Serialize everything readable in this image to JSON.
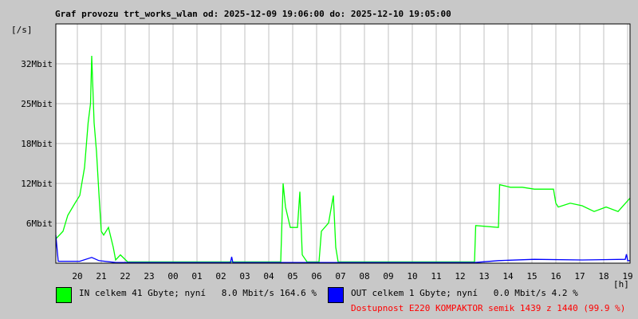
{
  "title": "Graf provozu trt_works_wlan od: 2025-12-09 19:06:00 do: 2025-12-10 19:05:00",
  "chart_data": {
    "type": "line",
    "ylabel": "[/s]",
    "xlabel": "[h]",
    "yticks": [
      "6Mbit",
      "12Mbit",
      "18Mbit",
      "25Mbit",
      "32Mbit"
    ],
    "ytick_values": [
      6.25,
      12.5,
      18.75,
      25,
      31.25
    ],
    "ylim": [
      0,
      37.5
    ],
    "xticks": [
      "20",
      "21",
      "22",
      "23",
      "00",
      "01",
      "02",
      "03",
      "04",
      "05",
      "06",
      "07",
      "08",
      "09",
      "10",
      "11",
      "12",
      "13",
      "14",
      "15",
      "16",
      "17",
      "18",
      "19"
    ],
    "xlim_hours": [
      0,
      24
    ],
    "grid": true,
    "series": [
      {
        "name": "IN",
        "color": "#00ff00",
        "points": [
          [
            0,
            3.8
          ],
          [
            0.3,
            5
          ],
          [
            0.5,
            7.5
          ],
          [
            0.8,
            9.4
          ],
          [
            1.0,
            10.6
          ],
          [
            1.2,
            15
          ],
          [
            1.35,
            22
          ],
          [
            1.45,
            25
          ],
          [
            1.5,
            32.5
          ],
          [
            1.6,
            22
          ],
          [
            1.7,
            17.5
          ],
          [
            1.8,
            11
          ],
          [
            1.9,
            5
          ],
          [
            2.0,
            4.4
          ],
          [
            2.2,
            5.6
          ],
          [
            2.4,
            2.5
          ],
          [
            2.5,
            0.5
          ],
          [
            2.7,
            1.3
          ],
          [
            3,
            0.2
          ],
          [
            6,
            0.2
          ],
          [
            9.4,
            0.2
          ],
          [
            9.5,
            12.5
          ],
          [
            9.6,
            8.8
          ],
          [
            9.8,
            5.6
          ],
          [
            10.1,
            5.6
          ],
          [
            10.2,
            11.2
          ],
          [
            10.3,
            1.3
          ],
          [
            10.5,
            0.2
          ],
          [
            11.0,
            0.2
          ],
          [
            11.1,
            5
          ],
          [
            11.4,
            6.3
          ],
          [
            11.6,
            10.6
          ],
          [
            11.7,
            2.5
          ],
          [
            11.8,
            0.2
          ],
          [
            17.5,
            0.2
          ],
          [
            17.55,
            5.9
          ],
          [
            18.5,
            5.6
          ],
          [
            18.55,
            12.3
          ],
          [
            19,
            11.9
          ],
          [
            19.5,
            11.9
          ],
          [
            20,
            11.6
          ],
          [
            20.8,
            11.6
          ],
          [
            20.9,
            9.4
          ],
          [
            21,
            8.8
          ],
          [
            21.5,
            9.4
          ],
          [
            22,
            9
          ],
          [
            22.5,
            8.1
          ],
          [
            23,
            8.8
          ],
          [
            23.5,
            8.1
          ],
          [
            24,
            10.2
          ]
        ]
      },
      {
        "name": "OUT",
        "color": "#0000ff",
        "points": [
          [
            0,
            4.4
          ],
          [
            0.1,
            0.3
          ],
          [
            1,
            0.3
          ],
          [
            1.5,
            0.9
          ],
          [
            1.8,
            0.4
          ],
          [
            2.5,
            0.1
          ],
          [
            7.3,
            0.1
          ],
          [
            7.35,
            1
          ],
          [
            7.4,
            0.1
          ],
          [
            17.5,
            0.1
          ],
          [
            18.5,
            0.4
          ],
          [
            20,
            0.6
          ],
          [
            22,
            0.5
          ],
          [
            23.8,
            0.6
          ],
          [
            23.85,
            1.4
          ],
          [
            23.9,
            0.4
          ],
          [
            24,
            0.4
          ]
        ]
      }
    ]
  },
  "legend": {
    "in_text": "IN celkem 41 Gbyte; nyní   8.0 Mbit/s 164.6 %",
    "out_text": "OUT celkem 1 Gbyte; nyní   0.0 Mbit/s 4.2 %",
    "availability": "Dostupnost E220 KOMPAKTOR semik 1439 z 1440 (99.9 %)",
    "availability_color": "#ff0000"
  }
}
